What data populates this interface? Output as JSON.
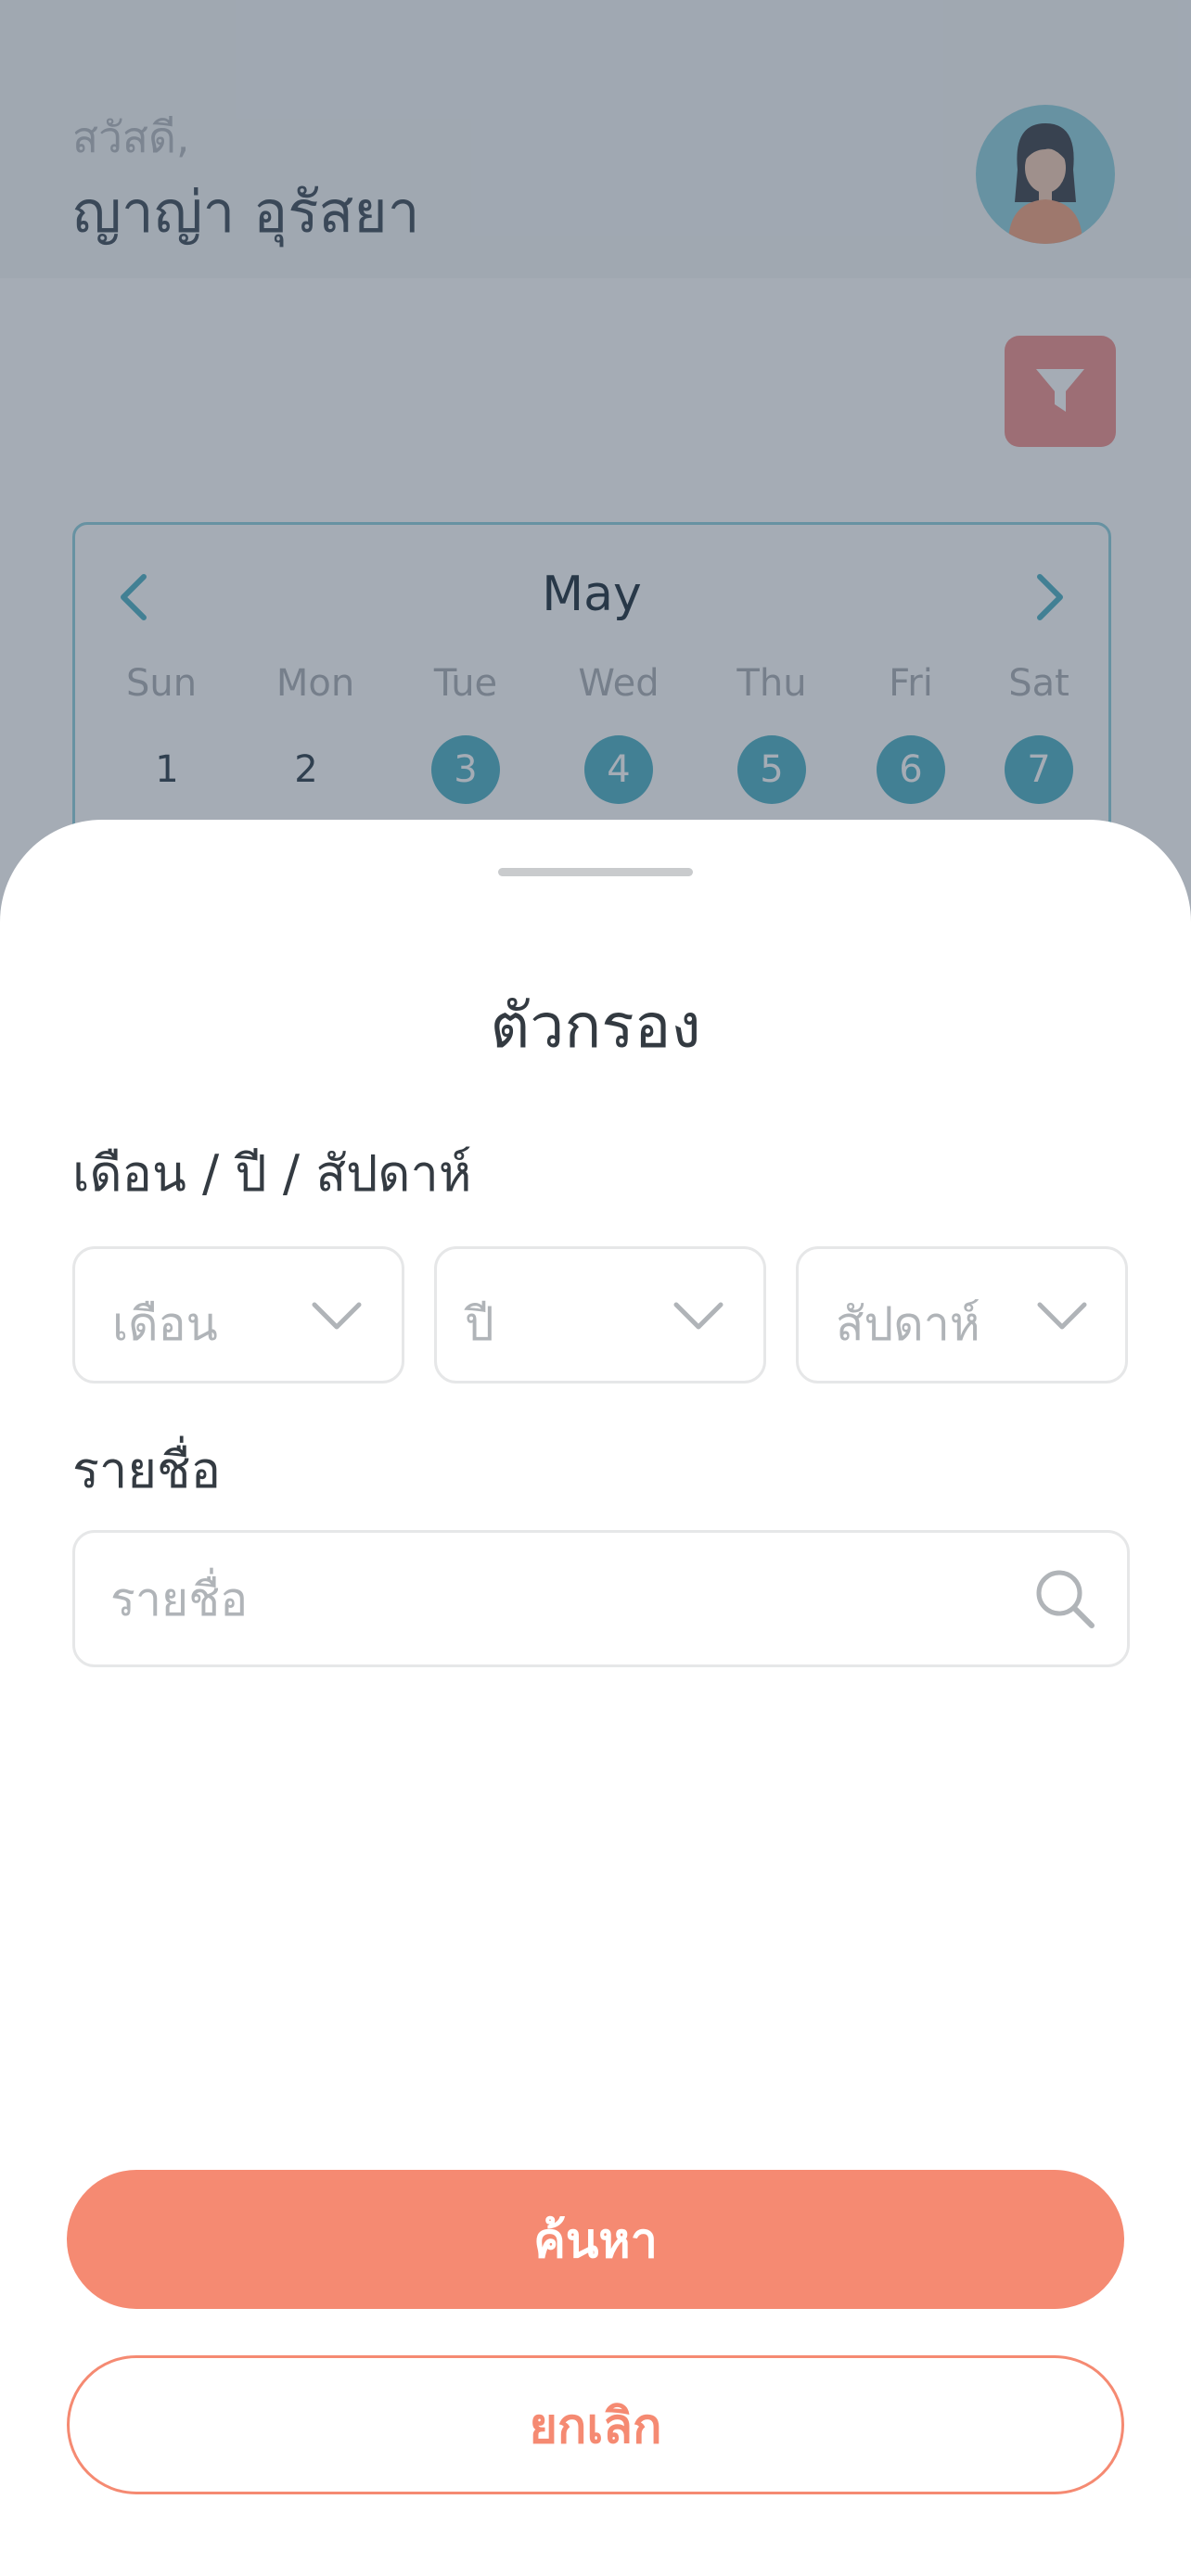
{
  "background": {
    "greeting": "สวัสดี,",
    "username": "ญาญ่า อุรัสยา",
    "calendar": {
      "month": "May",
      "weekdays": [
        "Sun",
        "Mon",
        "Tue",
        "Wed",
        "Thu",
        "Fri",
        "Sat"
      ],
      "days": [
        "1",
        "2",
        "3",
        "4",
        "5",
        "6",
        "7"
      ],
      "selected_days": [
        "3",
        "4",
        "5",
        "6",
        "7"
      ]
    }
  },
  "sheet": {
    "title": "ตัวกรอง",
    "period_label": "เดือน / ปี / สัปดาห์",
    "month_select": {
      "placeholder": "เดือน"
    },
    "year_select": {
      "placeholder": "ปี"
    },
    "week_select": {
      "placeholder": "สัปดาห์"
    },
    "name_label": "รายชื่อ",
    "name_search": {
      "placeholder": "รายชื่อ",
      "value": ""
    },
    "search_button": "ค้นหา",
    "cancel_button": "ยกเลิก"
  },
  "colors": {
    "accent": "#f58a72",
    "teal": "#4bb0c4",
    "filter": "#f08e8a"
  }
}
